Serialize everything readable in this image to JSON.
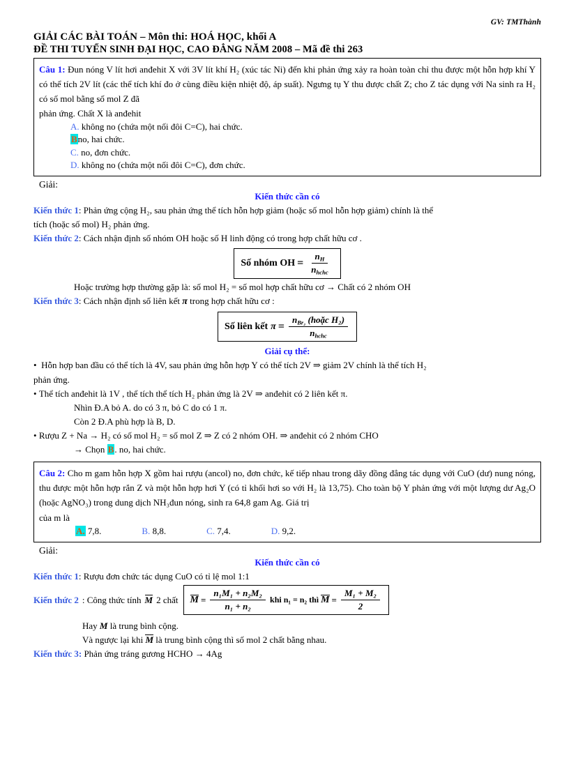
{
  "header": {
    "teacher": "GV: TMThành",
    "title_line1": "GIẢI CÁC BÀI TOÁN – Môn thi: HOÁ HỌC, khối A",
    "title_line2": "ĐỀ THI TUYỂN SINH ĐẠI HỌC, CAO ĐẲNG NĂM 2008 – Mã đề thi 263"
  },
  "question1": {
    "label": "Câu 1:",
    "body_line1": "Đun nóng V lít hơi anđehit X với 3V lít khí H₂ (xúc tác Ni) đến khi phản ứng xảy ra hoàn toàn chỉ thu",
    "body_line2": "được một hỗn hợp khí Y có thể tích 2V lít (các thể tích khí đo ở cùng điều kiện nhiệt độ, áp suất). Ngưng tụ Y thu được",
    "body_line3": "chất Z; cho Z tác dụng với Na sinh ra H₂ có số mol bằng số mol Z đã",
    "body_line4": "phản ứng. Chất X là anđehit",
    "options": [
      {
        "letter": "A.",
        "text": "không no (chứa một nối đôi C=C), hai chức.",
        "highlighted": false
      },
      {
        "letter": "B.",
        "text": "no, hai chức.",
        "highlighted": true
      },
      {
        "letter": "C.",
        "text": "no, đơn chức.",
        "highlighted": false
      },
      {
        "letter": "D.",
        "text": "không no (chứa một nối đôi C=C), đơn chức.",
        "highlighted": false
      }
    ]
  },
  "solution1": {
    "giai_label": "Giải:",
    "kien_thuc_can_co": "Kiến thức cần có",
    "kt1_tag": "Kiến thức 1",
    "kt1_line1": ": Phản ứng cộng H₂, sau phản ứng thể tích hỗn hợp giảm (hoặc số mol hỗn hợp giảm) chính là thể",
    "kt1_line2": "tích (hoặc số mol) H₂ phản ứng.",
    "kt2_tag": "Kiến thức 2",
    "kt2_line": ": Cách nhận định số nhóm OH hoặc số H linh động có trong hợp chất hữu cơ .",
    "formula1": {
      "label": "Số nhóm OH",
      "equals": "=",
      "numerator": "n",
      "numerator_sub": "H",
      "denominator": "n",
      "denominator_sub": "hchc"
    },
    "note_line": "Hoặc trường hợp thường gặp là: số mol H₂ = số mol hợp chất hữu cơ → Chất có 2 nhóm OH",
    "kt3_tag": "Kiến thức 3",
    "kt3_line_a": ": Cách nhận định số liên kết ",
    "kt3_pi": "π",
    "kt3_line_b": " trong hợp chất hữu cơ :",
    "formula2": {
      "label": "Số liên kết",
      "pi": "π",
      "equals": "=",
      "numerator_n": "n",
      "numerator_sub": "Br₂",
      "numerator_rest": "(hoặc H₂)",
      "denominator": "n",
      "denominator_sub": "hchc"
    },
    "giai_cu_the": "Giải cụ thể:",
    "b1_line1": "Hỗn hợp ban đầu có thể tích là 4V, sau phản ứng hỗn hợp Y có thể tích 2V ⇒ giảm 2V chính là thể tích H₂",
    "b1_line2": "phản ứng.",
    "b2_line": "Thể tích anđehit là 1V , thể tích thể tích H₂ phản ứng là 2V ⇒ anđehit có 2 liên kết π.",
    "b2_sub1": "Nhìn Đ.A bỏ A. do có 3 π, bỏ C do có 1 π.",
    "b2_sub2": "Còn 2 Đ.A phù hợp là B, D.",
    "b3_line": "Rượu Z + Na → H₂ có số mol H₂ = số mol Z  ⇒ Z có 2 nhóm OH. ⇒ anđehit có 2 nhóm CHO",
    "b3_choose_prefix": "→ Chọn ",
    "b3_choose_letter": "B",
    "b3_choose_suffix": ". no, hai chức."
  },
  "question2": {
    "label": "Câu 2:",
    "body_line1": "Cho m gam hỗn hợp X gồm hai rượu (ancol) no, đơn chức, kế tiếp nhau trong dãy đồng đẳng tác dụng với CuO",
    "body_line2": "(dư) nung nóng, thu được một hỗn hợp rắn Z và một hỗn hợp hơi Y (có tỉ khối hơi so với H₂ là 13,75). Cho toàn bộ Y",
    "body_line3": "phản ứng với một lượng dư Ag₂O (hoặc AgNO₃) trong dung dịch NH₃đun nóng, sinh ra 64,8 gam Ag. Giá trị",
    "body_line4": "của m là",
    "options": [
      {
        "letter": "A.",
        "text": "7,8.",
        "highlighted": true
      },
      {
        "letter": "B.",
        "text": "8,8.",
        "highlighted": false
      },
      {
        "letter": "C.",
        "text": "7,4.",
        "highlighted": false
      },
      {
        "letter": "D.",
        "text": "9,2.",
        "highlighted": false
      }
    ]
  },
  "solution2": {
    "giai_label": "Giải:",
    "kien_thuc_can_co": "Kiến thức cần có",
    "kt1_tag": "Kiến thức 1",
    "kt1_line": ": Rượu đơn chức tác dụng CuO có tỉ lệ mol 1:1",
    "kt2_tag": "Kiến thức 2",
    "kt2_prefix": ": Công thức tính",
    "kt2_mbar": "M",
    "kt2_suffix": "2 chất",
    "formula3": {
      "lhs": "M",
      "equals": "=",
      "num1": "n₁M₁ + n₂M₂",
      "den1": "n₁ + n₂",
      "mid": "khi n₁ = n₂ thì",
      "lhs2": "M",
      "equals2": "=",
      "num2": "M₁ + M₂",
      "den2": "2"
    },
    "hay_line_prefix": "Hay ",
    "hay_line_m": "M",
    "hay_line_suffix": " là trung bình cộng.",
    "vang_line_prefix": "Và ngược lại khi ",
    "vang_line_m": "M",
    "vang_line_suffix": " là trung bình cộng thì số mol 2 chất bằng nhau.",
    "kt3_tag": "Kiến thức 3:",
    "kt3_line": " Phản ứng tráng gương HCHO → 4Ag"
  },
  "colors": {
    "label_blue": "#1a1aff",
    "option_blue": "#4a6ef0",
    "kt_blue": "#3a5ce0",
    "highlight_bg": "#00e5e5",
    "highlight_fg": "#e05a10",
    "text": "#000000",
    "border": "#000000"
  }
}
